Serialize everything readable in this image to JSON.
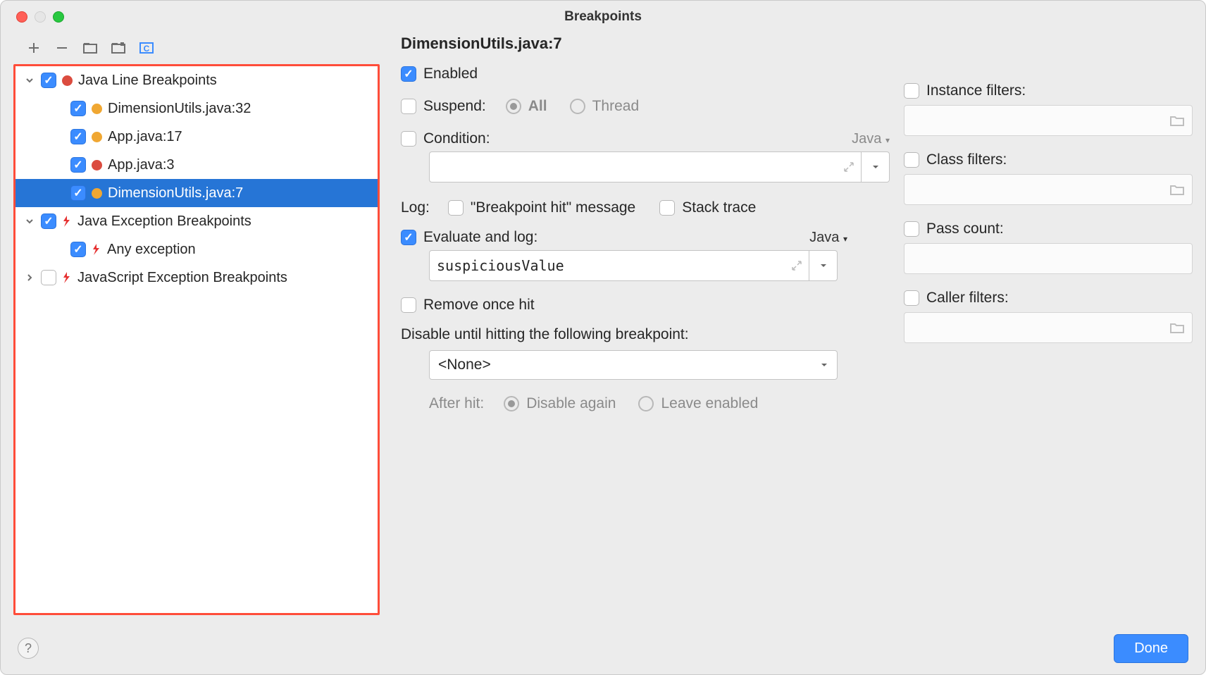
{
  "window": {
    "title": "Breakpoints"
  },
  "tree": {
    "groups": [
      {
        "expanded": true,
        "checked": true,
        "dot": "red",
        "label": "Java Line Breakpoints",
        "items": [
          {
            "checked": true,
            "dot": "orange",
            "label": "DimensionUtils.java:32"
          },
          {
            "checked": true,
            "dot": "orange",
            "label": "App.java:17"
          },
          {
            "checked": true,
            "dot": "red",
            "label": "App.java:3"
          },
          {
            "checked": true,
            "dot": "orange",
            "label": "DimensionUtils.java:7",
            "selected": true
          }
        ]
      },
      {
        "expanded": true,
        "checked": true,
        "exc": true,
        "label": "Java Exception Breakpoints",
        "items": [
          {
            "checked": true,
            "exc": true,
            "label": "Any exception"
          }
        ]
      },
      {
        "expanded": false,
        "checked": false,
        "exc": true,
        "label": "JavaScript Exception Breakpoints",
        "items": []
      }
    ]
  },
  "detail": {
    "title": "DimensionUtils.java:7",
    "enabled_label": "Enabled",
    "enabled_checked": true,
    "suspend_label": "Suspend:",
    "suspend_checked": false,
    "suspend_all": "All",
    "suspend_thread": "Thread",
    "condition_label": "Condition:",
    "condition_checked": false,
    "condition_lang": "Java",
    "log_label": "Log:",
    "log_hit_label": "\"Breakpoint hit\" message",
    "log_hit_checked": false,
    "log_stack_label": "Stack trace",
    "log_stack_checked": false,
    "eval_label": "Evaluate and log:",
    "eval_checked": true,
    "eval_lang": "Java",
    "eval_value": "suspiciousValue",
    "remove_label": "Remove once hit",
    "remove_checked": false,
    "disable_until_label": "Disable until hitting the following breakpoint:",
    "disable_until_value": "<None>",
    "after_hit_label": "After hit:",
    "after_hit_disable": "Disable again",
    "after_hit_leave": "Leave enabled",
    "filters": {
      "instance": "Instance filters:",
      "class": "Class filters:",
      "pass": "Pass count:",
      "caller": "Caller filters:"
    }
  },
  "footer": {
    "done": "Done"
  }
}
